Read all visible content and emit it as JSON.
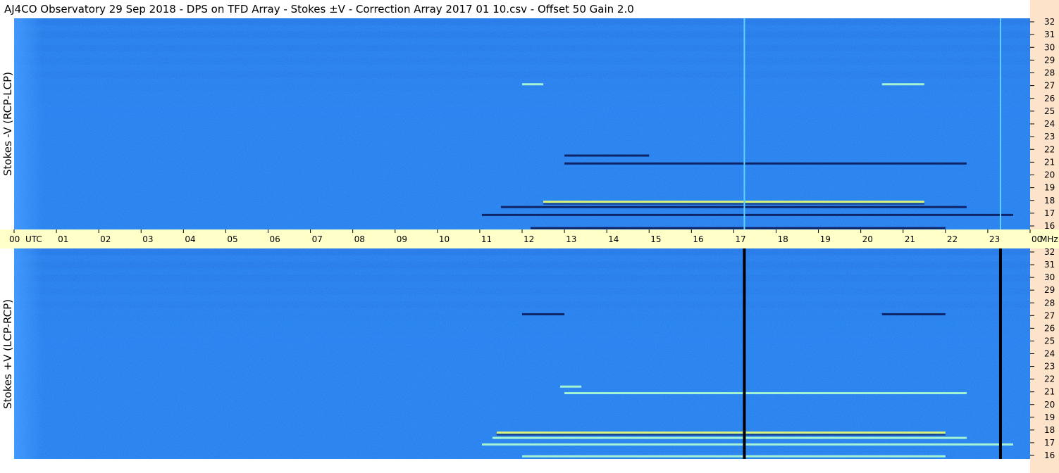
{
  "title": "AJ4CO Observatory  29 Sep 2018  -  DPS on TFD Array  -  Stokes ±V  -  Correction Array 2017 01 10.csv  -  Offset 50  Gain 2.0",
  "colors": {
    "background_blue": "#1f80f0",
    "dark_band": "#1456c8",
    "x_axis_band": "#ffffc8",
    "y_axis_strip": "#fde3c9",
    "feature_dark": "#0a1a5a",
    "feature_bright": "#b0ffd0"
  },
  "chart_data": [
    {
      "type": "heatmap",
      "panel": "top",
      "title": "",
      "ylabel": "Stokes -V  (RCP-LCP)",
      "xlabel": "UTC",
      "x_unit_label": "UTC",
      "y_unit_label": "MHz",
      "xlim": [
        0,
        24
      ],
      "ylim": [
        16,
        32
      ],
      "x_ticks": [
        "00",
        "01",
        "02",
        "03",
        "04",
        "05",
        "06",
        "07",
        "08",
        "09",
        "10",
        "11",
        "12",
        "13",
        "14",
        "15",
        "16",
        "17",
        "18",
        "19",
        "20",
        "21",
        "22",
        "23",
        "00"
      ],
      "y_ticks": [
        "32",
        "31",
        "30",
        "29",
        "28",
        "27",
        "26",
        "25",
        "24",
        "23",
        "22",
        "21",
        "20",
        "19",
        "18",
        "17",
        "16"
      ],
      "vertical_lines": [
        {
          "utc": 17.25,
          "style": "bright"
        },
        {
          "utc": 23.3,
          "style": "bright"
        }
      ],
      "horizontal_features": [
        {
          "freq_mhz": 17.1,
          "utc_start": 11.05,
          "utc_end": 23.6,
          "style": "dark"
        },
        {
          "freq_mhz": 17.7,
          "utc_start": 11.5,
          "utc_end": 22.5,
          "style": "dark"
        },
        {
          "freq_mhz": 18.1,
          "utc_start": 12.5,
          "utc_end": 21.5,
          "style": "mixed"
        },
        {
          "freq_mhz": 16.1,
          "utc_start": 12.2,
          "utc_end": 22.0,
          "style": "dark"
        },
        {
          "freq_mhz": 21.0,
          "utc_start": 13.0,
          "utc_end": 22.5,
          "style": "dark"
        },
        {
          "freq_mhz": 21.6,
          "utc_start": 13.0,
          "utc_end": 15.0,
          "style": "dark"
        },
        {
          "freq_mhz": 27.0,
          "utc_start": 12.0,
          "utc_end": 12.5,
          "style": "bright"
        },
        {
          "freq_mhz": 27.0,
          "utc_start": 20.5,
          "utc_end": 21.5,
          "style": "bright"
        }
      ]
    },
    {
      "type": "heatmap",
      "panel": "bottom",
      "title": "",
      "ylabel": "Stokes +V  (LCP-RCP)",
      "xlabel": "UTC",
      "x_unit_label": "UTC",
      "y_unit_label": "MHz",
      "xlim": [
        0,
        24
      ],
      "ylim": [
        16,
        32
      ],
      "x_ticks": [
        "00",
        "01",
        "02",
        "03",
        "04",
        "05",
        "06",
        "07",
        "08",
        "09",
        "10",
        "11",
        "12",
        "13",
        "14",
        "15",
        "16",
        "17",
        "18",
        "19",
        "20",
        "21",
        "22",
        "23",
        "00"
      ],
      "y_ticks": [
        "32",
        "31",
        "30",
        "29",
        "28",
        "27",
        "26",
        "25",
        "24",
        "23",
        "22",
        "21",
        "20",
        "19",
        "18",
        "17",
        "16"
      ],
      "vertical_lines": [
        {
          "utc": 17.25,
          "style": "black"
        },
        {
          "utc": 23.3,
          "style": "black"
        }
      ],
      "horizontal_features": [
        {
          "freq_mhz": 17.1,
          "utc_start": 11.05,
          "utc_end": 23.6,
          "style": "bright"
        },
        {
          "freq_mhz": 17.6,
          "utc_start": 11.3,
          "utc_end": 22.5,
          "style": "bright"
        },
        {
          "freq_mhz": 18.0,
          "utc_start": 11.4,
          "utc_end": 22.0,
          "style": "mixed"
        },
        {
          "freq_mhz": 16.2,
          "utc_start": 12.0,
          "utc_end": 22.0,
          "style": "bright"
        },
        {
          "freq_mhz": 21.0,
          "utc_start": 13.0,
          "utc_end": 22.5,
          "style": "bright"
        },
        {
          "freq_mhz": 21.5,
          "utc_start": 12.9,
          "utc_end": 13.4,
          "style": "bright"
        },
        {
          "freq_mhz": 27.0,
          "utc_start": 12.0,
          "utc_end": 13.0,
          "style": "dark"
        },
        {
          "freq_mhz": 27.0,
          "utc_start": 20.5,
          "utc_end": 22.0,
          "style": "dark"
        }
      ]
    }
  ]
}
